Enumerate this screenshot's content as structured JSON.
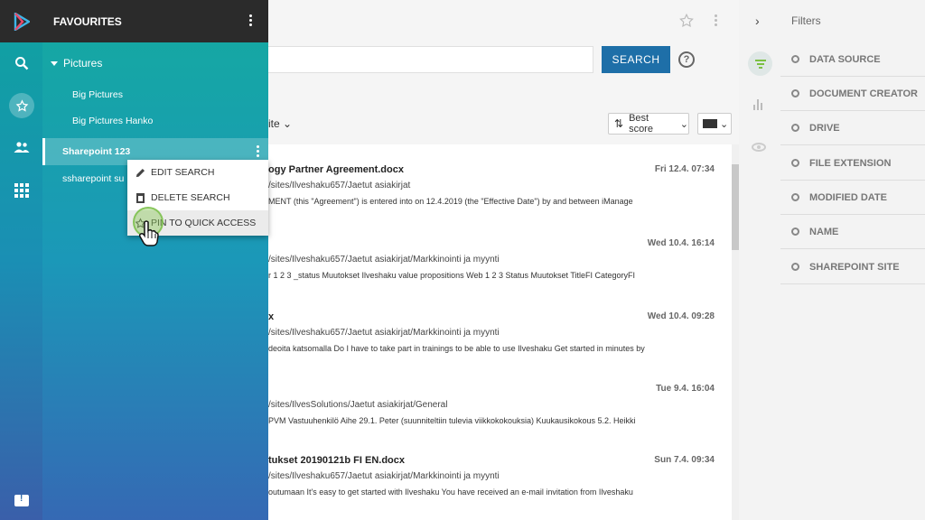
{
  "favourites": {
    "title": "FAVOURITES",
    "group_label": "Pictures",
    "group_items": [
      "Big Pictures",
      "Big Pictures Hanko"
    ],
    "selected_label": "Sharepoint 123",
    "other_item": "ssharepoint su"
  },
  "context_menu": {
    "edit": "EDIT SEARCH",
    "delete": "DELETE SEARCH",
    "pin": "PIN TO QUICK ACCESS"
  },
  "search": {
    "button": "SEARCH",
    "help": "?"
  },
  "toolbar": {
    "sort_tail": "ite",
    "sort_value": "Best score"
  },
  "results": [
    {
      "title": "ogy Partner Agreement.docx",
      "date": "Fri 12.4. 07:34",
      "path": "/sites/Ilveshaku657/Jaetut asiakirjat",
      "snippet": "MENT (this \"Agreement\") is entered into on 12.4.2019 (the \"Effective Date\") by and between iManage"
    },
    {
      "title": "",
      "date": "Wed 10.4. 16:14",
      "path": "/sites/Ilveshaku657/Jaetut asiakirjat/Markkinointi ja myynti",
      "snippet": "r 1 2 3 _status Muutokset Ilveshaku value propositions Web 1 2 3 Status Muutokset TitleFI CategoryFI"
    },
    {
      "title": "x",
      "date": "Wed 10.4. 09:28",
      "path": "/sites/Ilveshaku657/Jaetut asiakirjat/Markkinointi ja myynti",
      "snippet": "deoita katsomalla Do I have to take part in trainings to be able to use Ilveshaku Get started in minutes by"
    },
    {
      "title": "",
      "date": "Tue 9.4. 16:04",
      "path": "/sites/IlvesSolutions/Jaetut asiakirjat/General",
      "snippet": "PVM Vastuuhenkilö Aihe 29.1. Peter (suunniteltiin tulevia viikkokokouksia) Kuukausikokous 5.2. Heikki"
    },
    {
      "title": "tukset 20190121b FI EN.docx",
      "date": "Sun 7.4. 09:34",
      "path": "/sites/Ilveshaku657/Jaetut asiakirjat/Markkinointi ja myynti",
      "snippet": "outumaan It's easy to get started with Ilveshaku You have received an e-mail invitation from Ilveshaku"
    }
  ],
  "filters": {
    "title": "Filters",
    "items": [
      "DATA SOURCE",
      "DOCUMENT CREATOR",
      "DRIVE",
      "FILE EXTENSION",
      "MODIFIED DATE",
      "NAME",
      "SHAREPOINT SITE"
    ]
  },
  "icons": {
    "rail": [
      "app-logo-icon",
      "search-icon",
      "star-icon",
      "people-icon",
      "apps-grid-icon",
      "feedback-icon"
    ],
    "right_rail": [
      "chevron-right-icon",
      "filter-icon",
      "bar-chart-icon",
      "eye-icon"
    ]
  },
  "colors": {
    "accent": "#1e6fa8",
    "filter_active": "#7cc043",
    "header_dark": "#2b2b2b",
    "panel_teal": "#14aaa0",
    "panel_blue": "#3569b4"
  }
}
